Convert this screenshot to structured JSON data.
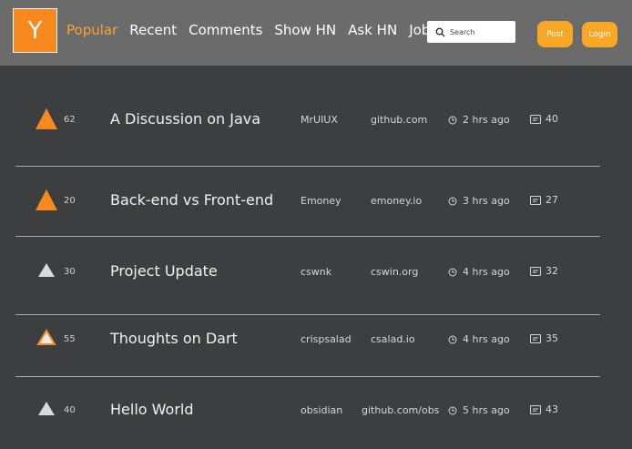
{
  "header": {
    "logo_letter": "Y",
    "nav": [
      "Popular",
      "Recent",
      "Comments",
      "Show HN",
      "Ask HN",
      "Jobs"
    ],
    "search_placeholder": "Search",
    "post_label": "Post",
    "login_label": "Login"
  },
  "colors": {
    "accent": "#f7891f",
    "upvoted": "#f7891f",
    "neutral_arrow": "#d9d9d9",
    "background": "#3d3e40",
    "header": "#6b6b6b"
  },
  "stories": [
    {
      "score": "62",
      "title": "A Discussion on Java",
      "user": "MrUIUX",
      "domain": "github.com",
      "time": "2 hrs ago",
      "comments": "40",
      "vote_state": "upvoted"
    },
    {
      "score": "20",
      "title": "Back-end vs Front-end",
      "user": "Emoney",
      "domain": "emoney.io",
      "time": "3 hrs ago",
      "comments": "27",
      "vote_state": "upvoted"
    },
    {
      "score": "30",
      "title": "Project Update",
      "user": "cswnk",
      "domain": "cswin.org",
      "time": "4 hrs ago",
      "comments": "32",
      "vote_state": "none"
    },
    {
      "score": "55",
      "title": "Thoughts on Dart",
      "user": "crispsalad",
      "domain": "csalad.io",
      "time": "4 hrs ago",
      "comments": "35",
      "vote_state": "hover"
    },
    {
      "score": "40",
      "title": "Hello World",
      "user": "obsidian",
      "domain": "github.com/obs",
      "time": "5 hrs ago",
      "comments": "43",
      "vote_state": "none"
    }
  ]
}
